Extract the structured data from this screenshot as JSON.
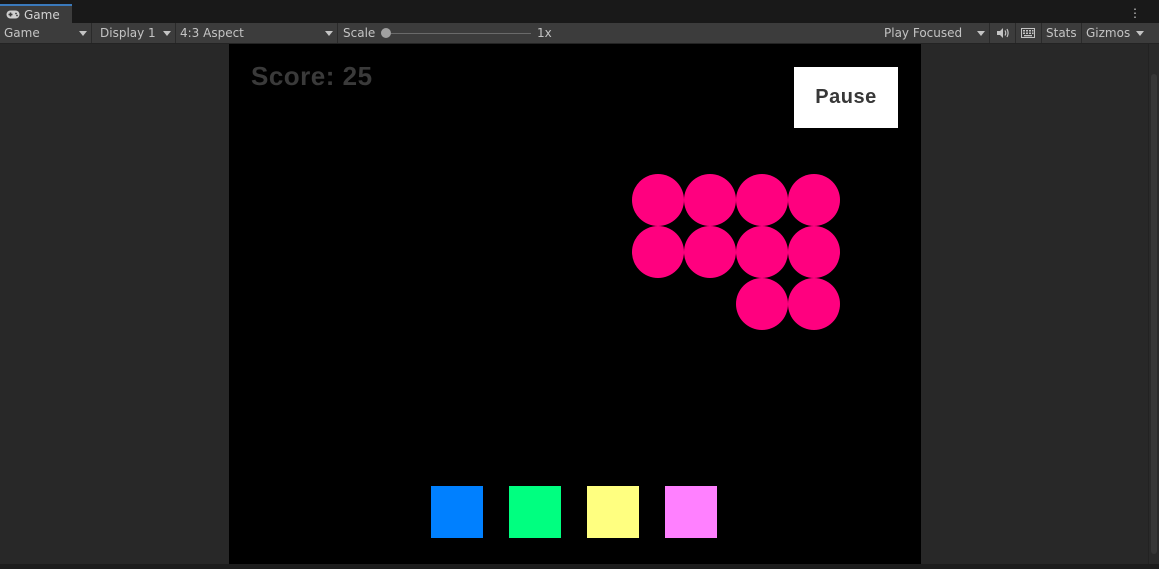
{
  "tab": {
    "label": "Game",
    "icon": "gamepad-icon"
  },
  "toolbar": {
    "view_select": "Game",
    "display_select": "Display 1",
    "aspect_select": "4:3 Aspect",
    "scale_label": "Scale",
    "scale_value": "1x",
    "play_mode_select": "Play Focused",
    "stats_label": "Stats",
    "gizmos_label": "Gizmos",
    "audio_icon": "speaker-icon",
    "keyboard_icon": "keyboard-icon"
  },
  "game": {
    "score_text": "Score: 25",
    "pause_label": "Pause",
    "ball_color": "#ff007f",
    "balls": [
      {
        "row": 0,
        "col": 0
      },
      {
        "row": 0,
        "col": 1
      },
      {
        "row": 0,
        "col": 2
      },
      {
        "row": 0,
        "col": 3
      },
      {
        "row": 1,
        "col": 0
      },
      {
        "row": 1,
        "col": 1
      },
      {
        "row": 1,
        "col": 2
      },
      {
        "row": 1,
        "col": 3
      },
      {
        "row": 2,
        "col": 2
      },
      {
        "row": 2,
        "col": 3
      }
    ],
    "tiles": [
      {
        "name": "blue",
        "color": "#0080ff"
      },
      {
        "name": "green",
        "color": "#00ff80"
      },
      {
        "name": "yellow",
        "color": "#ffff80"
      },
      {
        "name": "pink",
        "color": "#ff80ff"
      }
    ]
  }
}
